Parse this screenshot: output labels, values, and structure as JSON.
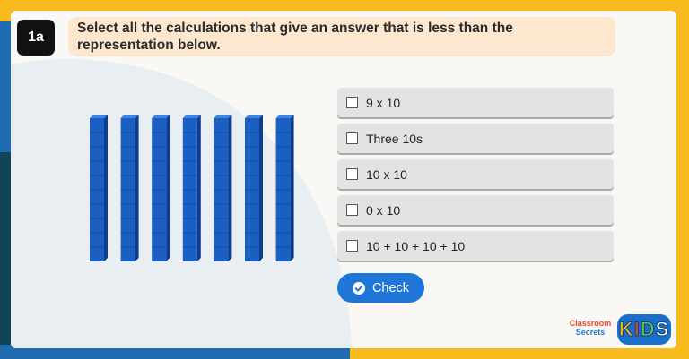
{
  "question": {
    "number": "1a",
    "text": "Select all the calculations that give an answer that is less than the representation below."
  },
  "options": [
    {
      "label": "9 x 10"
    },
    {
      "label": "Three 10s"
    },
    {
      "label": "10 x 10"
    },
    {
      "label": "0 x 10"
    },
    {
      "label": "10 + 10 + 10 + 10"
    }
  ],
  "check_button": {
    "label": "Check",
    "icon": "check-circle-icon"
  },
  "representation": {
    "rods": 7,
    "units_per_rod": 10
  },
  "branding": {
    "line1": "Classroom",
    "line2": "Secrets",
    "kids_letters": [
      "K",
      "I",
      "D",
      "S"
    ]
  },
  "colors": {
    "accent_yellow": "#f7bb1e",
    "accent_blue": "#1e6fb3",
    "accent_teal": "#0f4656",
    "rod_blue": "#1a5fc1",
    "button_blue": "#1e76d6",
    "question_bg": "#fde8cf",
    "option_bg": "#e3e3e3"
  }
}
